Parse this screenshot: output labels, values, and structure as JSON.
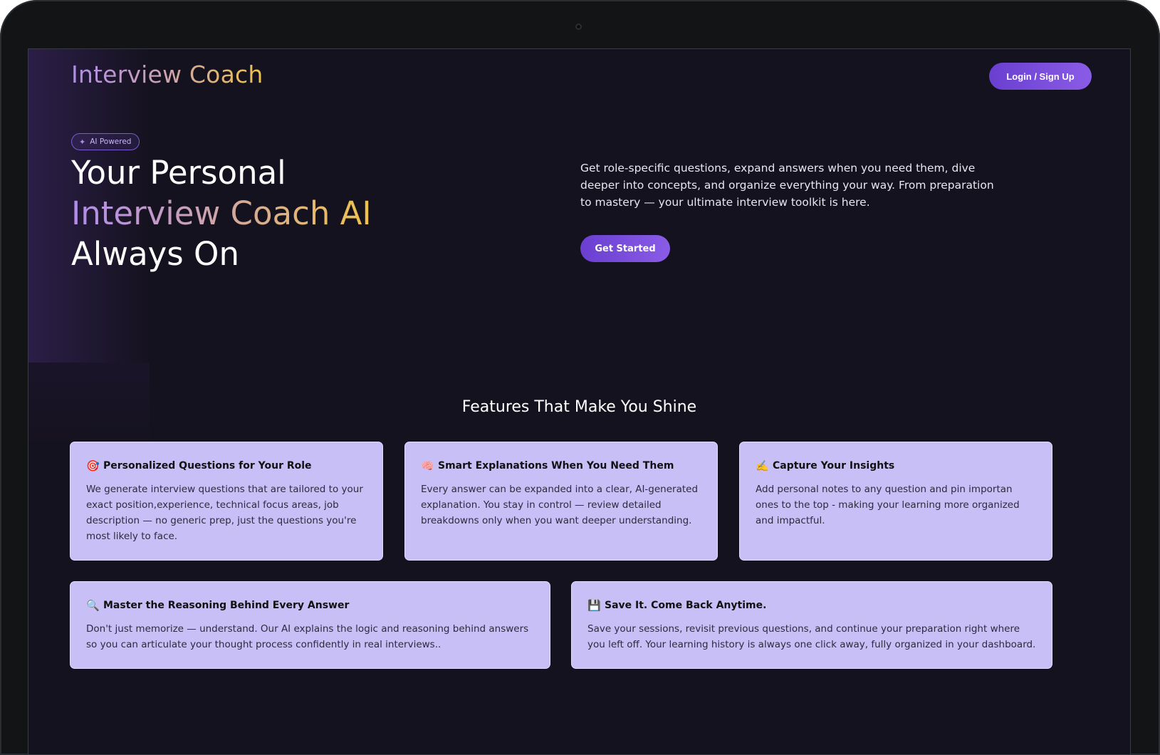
{
  "brand": {
    "name": "Interview Coach"
  },
  "nav": {
    "login_label": "Login / Sign Up"
  },
  "hero": {
    "badge": "AI Powered",
    "badge_icon": "sparkles-icon",
    "title_line1": "Your Personal",
    "title_line2": "Interview Coach AI",
    "title_line3": "Always On",
    "description": "Get role-specific questions, expand answers when you need them, dive deeper into concepts, and organize everything your way. From preparation to mastery — your ultimate interview toolkit is here.",
    "cta_label": "Get Started"
  },
  "features": {
    "heading": "Features That Make You Shine",
    "items": [
      {
        "icon": "🎯",
        "icon_name": "target-icon",
        "title": "Personalized Questions for Your Role",
        "body": "We generate interview questions that are tailored to your exact position,experience, technical focus areas, job description — no generic prep, just the questions you're most likely to face."
      },
      {
        "icon": "🧠",
        "icon_name": "brain-icon",
        "title": "Smart Explanations When You Need Them",
        "body": "Every answer can be expanded into a clear, AI-generated explanation. You stay in control — review detailed breakdowns only when you want deeper understanding."
      },
      {
        "icon": "✍️",
        "icon_name": "writing-hand-icon",
        "title": "Capture Your Insights",
        "body": "Add personal notes to any question and pin importan ones to the top - making your learning more organized and impactful."
      },
      {
        "icon": "🔍",
        "icon_name": "magnifier-icon",
        "title": "Master the Reasoning Behind Every Answer",
        "body": "Don't just memorize — understand. Our AI explains the logic and reasoning behind answers so you can articulate your thought process confidently in real interviews.."
      },
      {
        "icon": "💾",
        "icon_name": "floppy-disk-icon",
        "title": "Save It. Come Back Anytime.",
        "body": "Save your sessions, revisit previous questions, and continue your preparation right where you left off. Your learning history is always one click away, fully organized in your dashboard."
      }
    ]
  },
  "colors": {
    "background": "#15121f",
    "accent": "#7c4ddc",
    "card": "#c7bff5",
    "gradient_start": "#b08ce8",
    "gradient_end": "#f0c34a"
  }
}
